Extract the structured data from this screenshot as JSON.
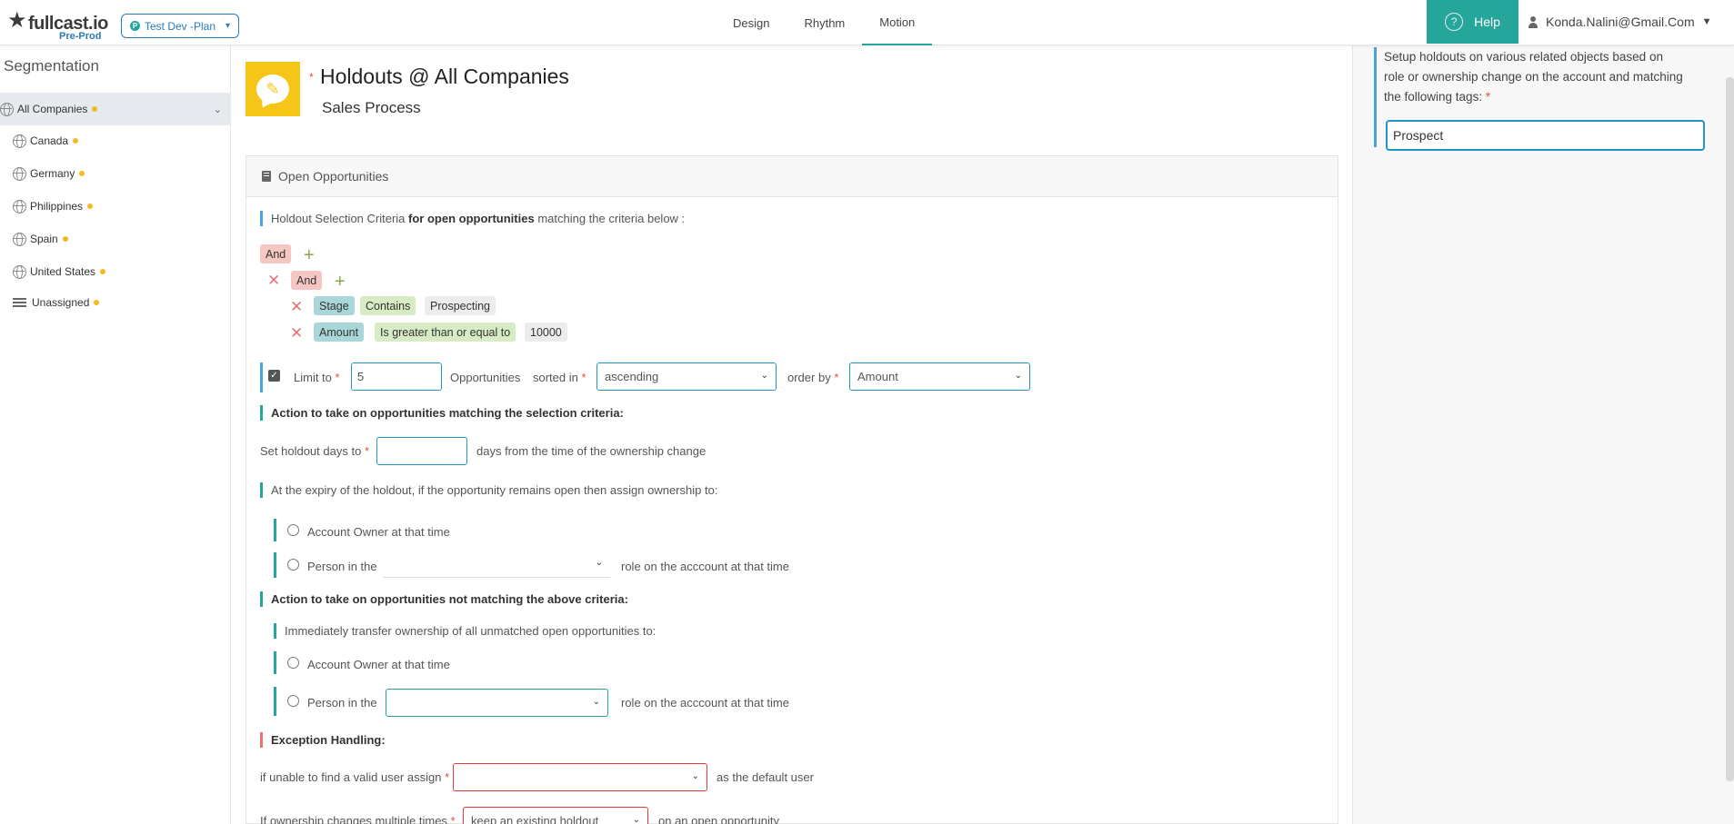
{
  "topbar": {
    "logo_word": "fullcast.io",
    "logo_env": "Pre-Prod",
    "plan_badge": "P",
    "plan_label": "Test Dev -Plan",
    "nav": [
      "Design",
      "Rhythm",
      "Motion"
    ],
    "active_nav": "Motion",
    "help_label": "Help",
    "user_email": "Konda.Nalini@Gmail.Com"
  },
  "sidebar": {
    "title": "Segmentation",
    "items": [
      {
        "label": "All Companies",
        "icon": "globe-icon"
      },
      {
        "label": "Canada",
        "icon": "globe-icon"
      },
      {
        "label": "Germany",
        "icon": "globe-icon"
      },
      {
        "label": "Philippines",
        "icon": "globe-icon"
      },
      {
        "label": "Spain",
        "icon": "globe-icon"
      },
      {
        "label": "United States",
        "icon": "globe-icon"
      },
      {
        "label": "Unassigned",
        "icon": "list-icon"
      }
    ],
    "status_dot_color": "#f5b921"
  },
  "header": {
    "title": "Holdouts @ All Companies",
    "subtitle": "Sales Process",
    "icon_color": "#f5c518"
  },
  "panel": {
    "title": "Open Opportunities",
    "criteria": {
      "prefix": "Holdout Selection Criteria",
      "bold": "for open opportunities",
      "suffix": "matching the criteria below :"
    },
    "and_outer": "And",
    "and_inner": "And",
    "rule1": {
      "field": "Stage",
      "op": "Contains",
      "value": "Prospecting"
    },
    "rule2": {
      "field": "Amount",
      "op": "Is greater than or equal to",
      "value": "10000"
    },
    "limit": {
      "label": "Limit to",
      "value": "5",
      "unit": "Opportunities",
      "sorted_label": "sorted in",
      "sort_value": "ascending",
      "order_label": "order by",
      "order_value": "Amount"
    },
    "action_match_title": "Action to take on opportunities matching the selection criteria:",
    "holdout_days": {
      "prefix": "Set holdout days to",
      "suffix": "days from the time of the ownership change",
      "value": ""
    },
    "expiry_title": "At the expiry of the holdout, if the opportunity remains open then assign ownership to:",
    "opt_account_owner": "Account Owner at that time",
    "opt_person_prefix": "Person in the",
    "opt_person_suffix": "role on the acccount at that time",
    "action_nomatch_title": "Action to take on opportunities not matching the above criteria:",
    "transfer_title": "Immediately transfer ownership of all unmatched open opportunities to:",
    "exception_title": "Exception Handling:",
    "exc1": {
      "prefix": "if unable to find a valid user assign",
      "suffix": "as the default user"
    },
    "exc2": {
      "prefix": "If ownership changes multiple times",
      "select": "keep an existing holdout",
      "suffix": "on an open opportunity"
    }
  },
  "right": {
    "description": "Setup holdouts on various related objects based on role or ownership change on the account and matching the following tags:",
    "tag_value": "Prospect"
  },
  "colors": {
    "accent": "#26a69a",
    "required": "#e74c3c",
    "input_border": "#2196c4"
  }
}
